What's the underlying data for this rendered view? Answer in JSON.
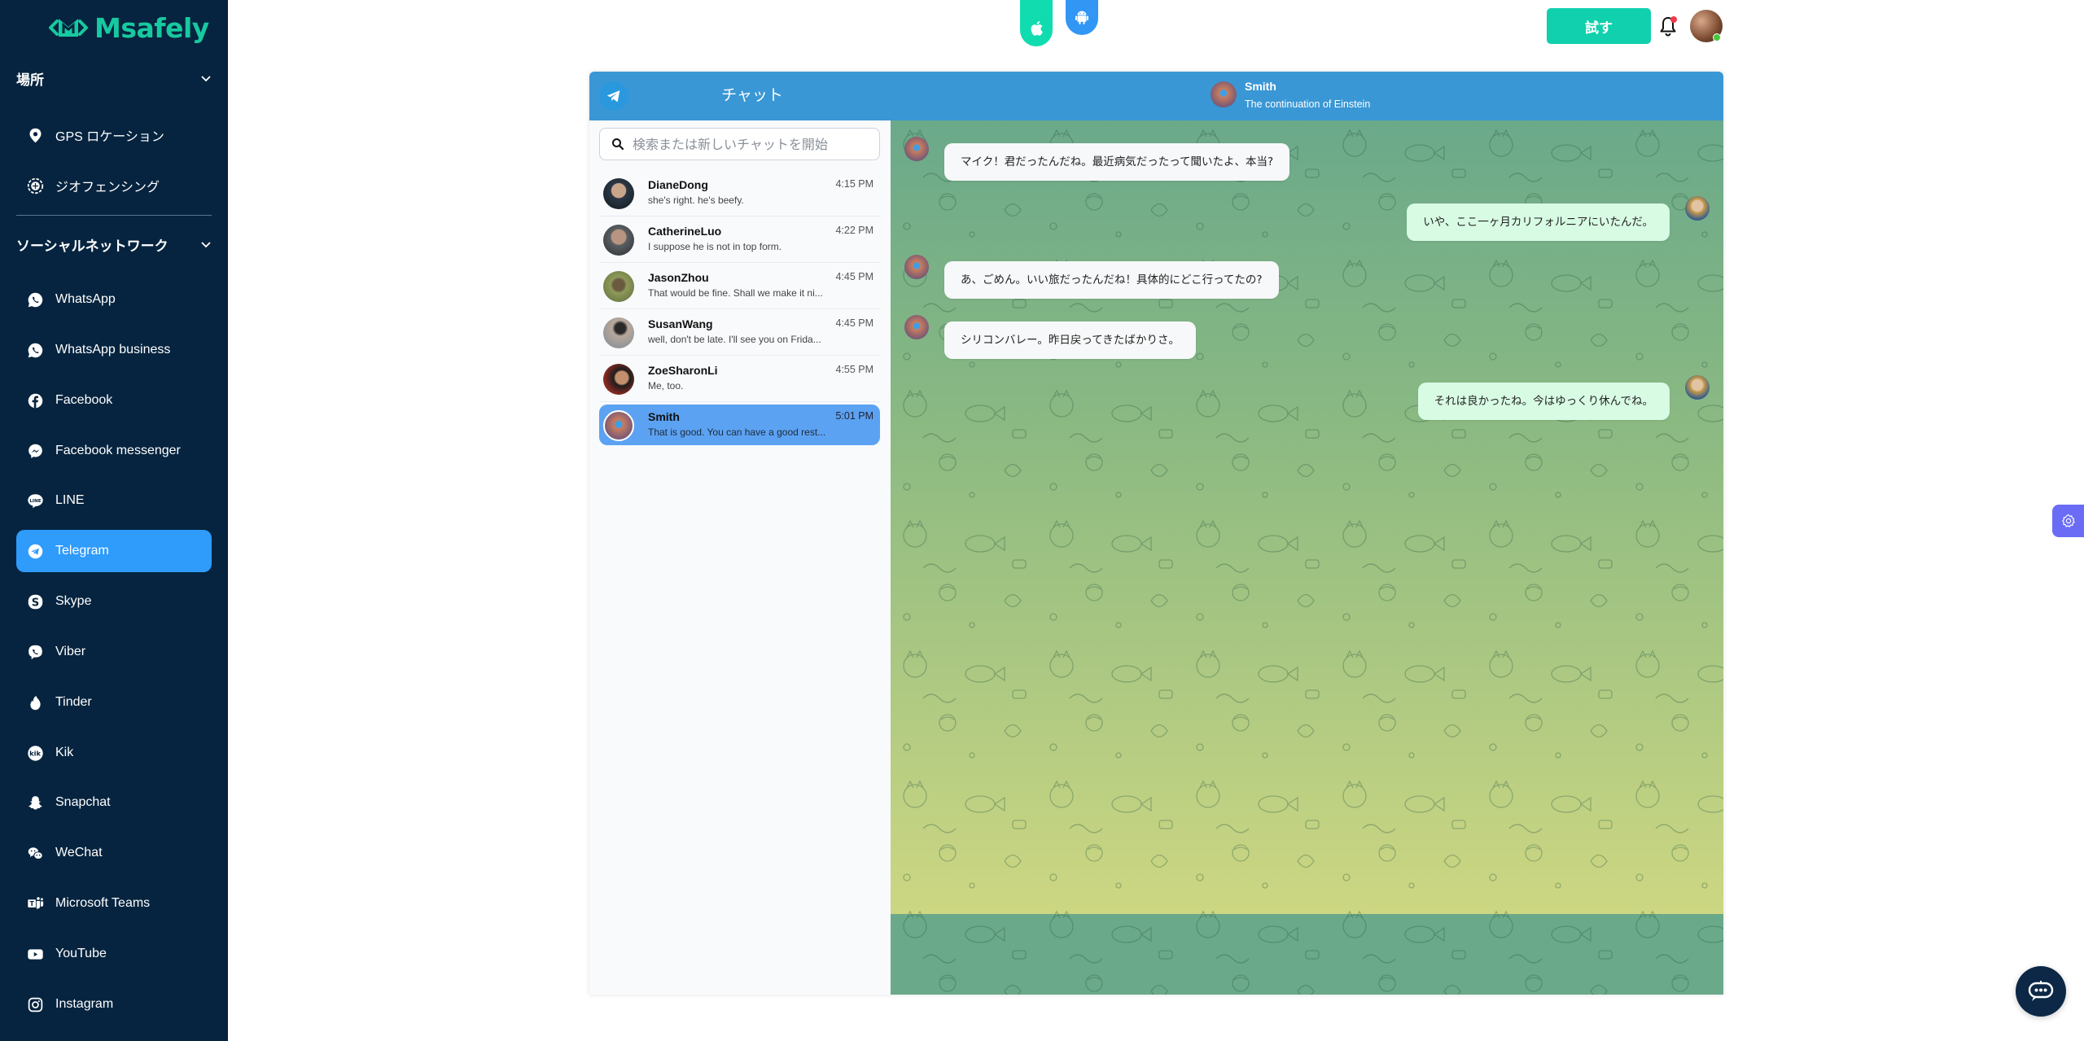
{
  "brand": {
    "name": "Msafely",
    "color": "#17c9a0"
  },
  "sidebar": {
    "sections": [
      {
        "label": "場所",
        "items": [
          {
            "label": "GPS ロケーション",
            "icon": "location-pin-icon"
          },
          {
            "label": "ジオフェンシング",
            "icon": "geofence-icon"
          }
        ]
      },
      {
        "label": "ソーシャルネットワーク",
        "items": [
          {
            "label": "WhatsApp",
            "icon": "whatsapp-icon"
          },
          {
            "label": "WhatsApp business",
            "icon": "whatsapp-business-icon"
          },
          {
            "label": "Facebook",
            "icon": "facebook-icon"
          },
          {
            "label": "Facebook messenger",
            "icon": "messenger-icon"
          },
          {
            "label": "LINE",
            "icon": "line-icon"
          },
          {
            "label": "Telegram",
            "icon": "telegram-icon",
            "active": true
          },
          {
            "label": "Skype",
            "icon": "skype-icon"
          },
          {
            "label": "Viber",
            "icon": "viber-icon"
          },
          {
            "label": "Tinder",
            "icon": "tinder-icon"
          },
          {
            "label": "Kik",
            "icon": "kik-icon"
          },
          {
            "label": "Snapchat",
            "icon": "snapchat-icon"
          },
          {
            "label": "WeChat",
            "icon": "wechat-icon"
          },
          {
            "label": "Microsoft Teams",
            "icon": "teams-icon"
          },
          {
            "label": "YouTube",
            "icon": "youtube-icon"
          },
          {
            "label": "Instagram",
            "icon": "instagram-icon"
          }
        ]
      }
    ],
    "active_color": "#2f9bfb",
    "bg_color": "#06243f"
  },
  "topbar": {
    "apple_icon": "apple-icon",
    "android_icon": "android-icon",
    "try_label": "試す",
    "try_color": "#10d0ad",
    "bell_icon": "bell-icon",
    "has_notification": true
  },
  "chat": {
    "left_title": "チャット",
    "search_placeholder": "検索または新しいチャットを開始",
    "contacts": [
      {
        "name": "DianeDong",
        "time": "4:15 PM",
        "preview": "she's right. he's beefy."
      },
      {
        "name": "CatherineLuo",
        "time": "4:22 PM",
        "preview": "I suppose he is not in top form."
      },
      {
        "name": "JasonZhou",
        "time": "4:45 PM",
        "preview": "That would be fine. Shall we make it ni..."
      },
      {
        "name": "SusanWang",
        "time": "4:45 PM",
        "preview": "well, don't be late. I'll see you on Frida..."
      },
      {
        "name": "ZoeSharonLi",
        "time": "4:55 PM",
        "preview": "Me, too."
      },
      {
        "name": "Smith",
        "time": "5:01 PM",
        "preview": "That is good. You can have a good rest...",
        "active": true
      }
    ],
    "peer": {
      "name": "Smith",
      "status": "The continuation of Einstein"
    },
    "messages": [
      {
        "direction": "in",
        "text": "マイク！君だったんだね。最近病気だったって聞いたよ、本当?"
      },
      {
        "direction": "out",
        "text": "いや、ここ一ヶ月カリフォルニアにいたんだ。"
      },
      {
        "direction": "in",
        "text": "あ、ごめん。いい旅だったんだね！具体的にどこ行ってたの?"
      },
      {
        "direction": "in",
        "text": "シリコンバレー。昨日戻ってきたばかりさ。"
      },
      {
        "direction": "out",
        "text": "それは良かったね。今はゆっくり休んでね。"
      }
    ],
    "header_color": "#3a97d5"
  },
  "floating": {
    "settings_icon": "gear-icon",
    "support_icon": "chat-support-icon"
  }
}
